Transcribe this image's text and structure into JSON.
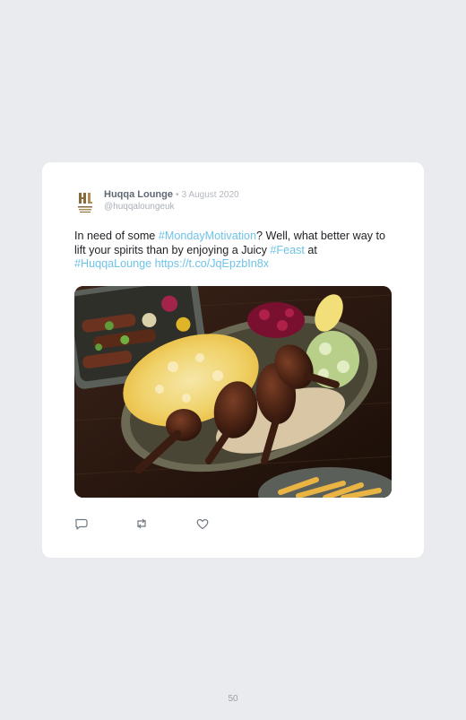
{
  "tweet": {
    "display_name": "Huqqa Lounge",
    "separator": "•",
    "date": "3 August 2020",
    "handle": "@huqqaloungeuk",
    "text_segments": {
      "t1": "In need of some ",
      "t2": "#MondayMotivation",
      "t3": "? Well, what better way to lift your spirits than by enjoying a Juicy ",
      "t4": "#Feast",
      "t5": " at ",
      "t6": "#HuqqaLounge",
      "t7": " ",
      "t8": "https://t.co/JqEpzbIn8x"
    },
    "avatar_icon": "huqqa-lounge-logo",
    "image_description_icon": "food-photo-lamb-chops-rice",
    "actions": [
      {
        "icon": "reply-icon"
      },
      {
        "icon": "retweet-icon"
      },
      {
        "icon": "like-icon"
      }
    ]
  },
  "colors": {
    "background": "#e9ebef",
    "card": "#ffffff",
    "link": "#6ec3e8",
    "name": "#5f6874",
    "muted": "#b3b8c0"
  },
  "page": {
    "number": "50"
  }
}
